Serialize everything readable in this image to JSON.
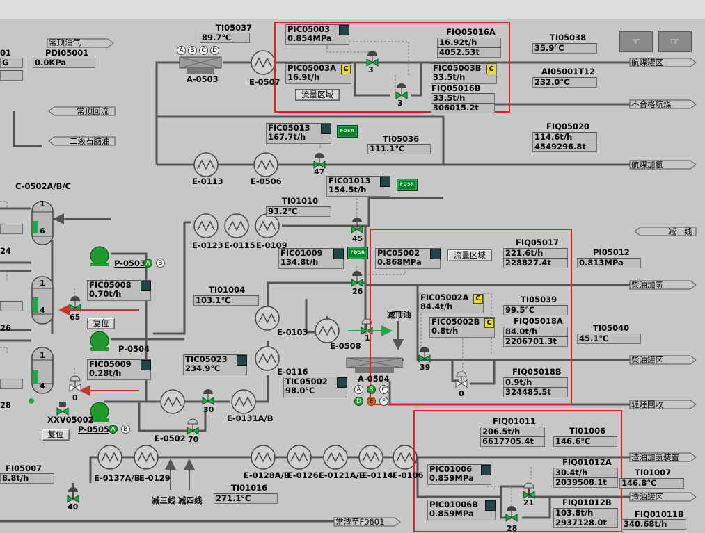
{
  "tags": {
    "TI05037": {
      "name": "TI05037",
      "value": "89.7℃"
    },
    "PDI05001": {
      "name": "PDI05001",
      "value": "0.0KPa"
    },
    "PIC05003": {
      "name": "PIC05003",
      "value": "0.854MPa"
    },
    "PIC05003A": {
      "name": "PIC05003A",
      "value": "16.9t/h"
    },
    "FIQ05016A": {
      "name": "FIQ05016A",
      "rate": "16.92t/h",
      "total": "4052.53t"
    },
    "FIC05003B": {
      "name": "FIC05003B",
      "value": "33.5t/h"
    },
    "FIQ05016B": {
      "name": "FIQ05016B",
      "rate": "33.5t/h",
      "total": "306015.2t"
    },
    "TI05038": {
      "name": "TI05038",
      "value": "35.9°C"
    },
    "AI05001T12": {
      "name": "AI05001T12",
      "value": "232.0°C"
    },
    "FIC05013": {
      "name": "FIC05013",
      "value": "167.7t/h"
    },
    "TI05036": {
      "name": "TI05036",
      "value": "111.1℃"
    },
    "FIQ05020": {
      "name": "FIQ05020",
      "rate": "114.6t/h",
      "total": "4549296.8t"
    },
    "FIC01013": {
      "name": "FIC01013",
      "value": "154.5t/h"
    },
    "TI01010": {
      "name": "TI01010",
      "value": "93.2℃"
    },
    "FIC01009": {
      "name": "FIC01009",
      "value": "134.8t/h"
    },
    "PIC05002": {
      "name": "PIC05002",
      "value": "0.868MPa"
    },
    "FIQ05017": {
      "name": "FIQ05017",
      "rate": "221.6t/h",
      "total": "228827.4t"
    },
    "PI05012": {
      "name": "PI05012",
      "value": "0.813MPa"
    },
    "FIC05008": {
      "name": "FIC05008",
      "value": "0.70t/h"
    },
    "TI01004": {
      "name": "TI01004",
      "value": "103.1℃"
    },
    "FIC05002A": {
      "name": "FIC05002A",
      "value": "84.4t/h"
    },
    "TI05039": {
      "name": "TI05039",
      "value": "99.5℃"
    },
    "FIC05002B": {
      "name": "FIC05002B",
      "value": "0.8t/h"
    },
    "FIQ05018A": {
      "name": "FIQ05018A",
      "rate": "84.0t/h",
      "total": "2206701.3t"
    },
    "TI05040": {
      "name": "TI05040",
      "value": "45.1℃"
    },
    "FIC05009": {
      "name": "FIC05009",
      "value": "0.28t/h"
    },
    "TIC05023": {
      "name": "TIC05023",
      "value": "234.9℃"
    },
    "TIC05002": {
      "name": "TIC05002",
      "value": "98.0℃"
    },
    "FIQ05018B": {
      "name": "FIQ05018B",
      "rate": "0.9t/h",
      "total": "324485.5t"
    },
    "FIQ01011": {
      "name": "FIQ01011",
      "rate": "206.5t/h",
      "total": "6617705.4t"
    },
    "TI01006": {
      "name": "TI01006",
      "value": "146.6℃"
    },
    "PIC01006": {
      "name": "PIC01006",
      "value": "0.859MPa"
    },
    "FIQ01012A": {
      "name": "FIQ01012A",
      "rate": "30.4t/h",
      "total": "2039508.1t"
    },
    "TI01007": {
      "name": "TI01007",
      "value": "146.8℃"
    },
    "PIC01006B": {
      "name": "PIC01006B",
      "value": "0.859MPa"
    },
    "FIQ01012B": {
      "name": "FIQ01012B",
      "rate": "103.8t/h",
      "total": "2937128.0t"
    },
    "FI05007": {
      "name": "FI05007",
      "value": "8.8t/h"
    },
    "TI01016": {
      "name": "TI01016",
      "value": "271.1℃"
    },
    "FIQ01011B": {
      "name": "FIQ01011B",
      "value": "340.68t/h"
    }
  },
  "left_partial": {
    "n01": "01",
    "g": "G",
    "v24": "24",
    "v26": "26",
    "v28": "28"
  },
  "streams": {
    "top_gas": "常顶油气",
    "top_reflux": "常顶回流",
    "naphtha2": "二级石脑油",
    "jet_tank": "航煤罐区",
    "offspec_jet": "不合格航煤",
    "jet_hydro": "航煤加氢",
    "line1": "减一线",
    "diesel_hydro": "柴油加氢",
    "diesel_tank": "柴油罐区",
    "light_wax": "轻烃回收",
    "wax_hydro": "渣油加氢装置",
    "wax_tank": "渣油罐区",
    "residue": "常渣至F0601",
    "vac_top_oil": "减顶油",
    "line3": "减三线",
    "line4": "减四线"
  },
  "equipment": {
    "a0503": "A-0503",
    "e0507": "E-0507",
    "e0113": "E-0113",
    "e0506": "E-0506",
    "c0502": "C-0502A/B/C",
    "e0123": "E-0123",
    "e0115": "E-0115",
    "e0109": "E-0109",
    "p0503": "P-0503",
    "p0504": "P-0504",
    "p0505": "P-0505",
    "e0103": "E-0103",
    "e0508": "E-0508",
    "a0504": "A-0504",
    "e0116": "E-0116",
    "e0131": "E-0131A/B",
    "e0502": "E-0502",
    "xxv05002": "XXV05002",
    "e0137": "E-0137A/B",
    "e0129": "E-0129",
    "e0128": "E-0128A/B",
    "e0126": "E-0126",
    "e0121": "E-0121A/B",
    "e0114": "E-0114",
    "e0106": "E-0106"
  },
  "valves": {
    "v3a": "3",
    "v3b": "3",
    "v47": "47",
    "v45": "45",
    "v26": "26",
    "v1": "1",
    "v65": "65",
    "v0a": "0",
    "v39": "39",
    "v0b": "0",
    "v30": "30",
    "v70": "70",
    "v40": "40",
    "v21": "21",
    "v28": "28"
  },
  "column_levels": {
    "c1_top": "1",
    "c1_mid": "6",
    "c2_top": "1",
    "c2_mid": "4",
    "c3_top": "1",
    "c3_mid": "4"
  },
  "buttons": {
    "flow_area_1": "流量区域",
    "flow_area_2": "流量区域",
    "reset_1": "复位",
    "reset_2": "复位",
    "fdsr": "FDSR"
  },
  "badges": {
    "c": "C",
    "fan_a": "A",
    "fan_b": "B",
    "fan_c": "C",
    "fan_d": "D",
    "fan_e": "E",
    "fan_f": "F"
  },
  "colors": {
    "background": "#c7c7c7",
    "pipe": "#555555",
    "pump_green": "#1f9a2e",
    "alarm_frame": "#e02020",
    "controller_mode": "#22454a",
    "hot_arrow": "#c0392b"
  },
  "nav": {
    "prev_icon": "hand-left-icon",
    "next_icon": "hand-right-icon"
  }
}
